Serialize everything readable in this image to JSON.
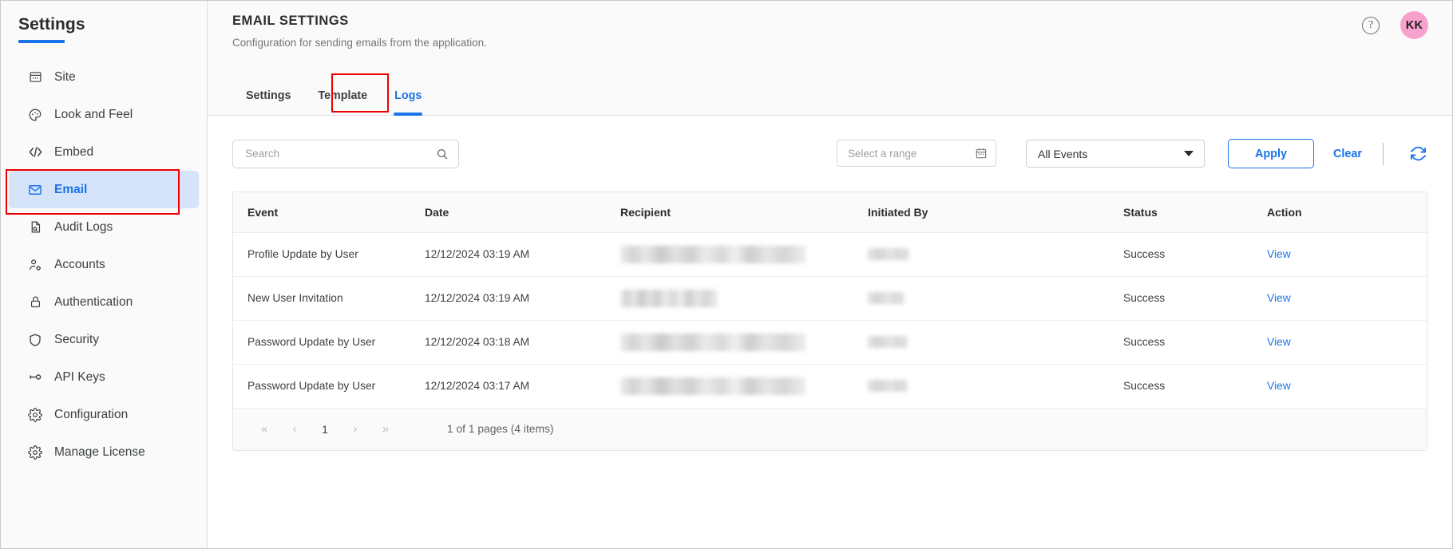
{
  "sidebar": {
    "title": "Settings",
    "items": [
      {
        "label": "Site",
        "icon": "site-icon",
        "active": false
      },
      {
        "label": "Look and Feel",
        "icon": "palette-icon",
        "active": false
      },
      {
        "label": "Embed",
        "icon": "code-icon",
        "active": false
      },
      {
        "label": "Email",
        "icon": "envelope-icon",
        "active": true
      },
      {
        "label": "Audit Logs",
        "icon": "document-search-icon",
        "active": false
      },
      {
        "label": "Accounts",
        "icon": "person-gear-icon",
        "active": false
      },
      {
        "label": "Authentication",
        "icon": "lock-icon",
        "active": false
      },
      {
        "label": "Security",
        "icon": "shield-icon",
        "active": false
      },
      {
        "label": "API Keys",
        "icon": "key-icon",
        "active": false
      },
      {
        "label": "Configuration",
        "icon": "gear-icon",
        "active": false
      },
      {
        "label": "Manage License",
        "icon": "gear-license-icon",
        "active": false
      }
    ]
  },
  "header": {
    "title": "EMAIL SETTINGS",
    "subtitle": "Configuration for sending emails from the application.",
    "help_icon": "question-mark-icon",
    "avatar_initials": "KK",
    "avatar_color": "#f9a1cd"
  },
  "tabs": [
    {
      "label": "Settings",
      "active": false
    },
    {
      "label": "Template",
      "active": false
    },
    {
      "label": "Logs",
      "active": true
    }
  ],
  "toolbar": {
    "search_placeholder": "Search",
    "search_value": "",
    "date_range_placeholder": "Select a range",
    "event_filter_value": "All Events",
    "apply_label": "Apply",
    "clear_label": "Clear",
    "refresh_icon": "refresh-icon"
  },
  "table": {
    "columns": [
      "Event",
      "Date",
      "Recipient",
      "Initiated By",
      "Status",
      "Action"
    ],
    "rows": [
      {
        "event": "Profile Update by User",
        "date": "12/12/2024 03:19 AM",
        "recipient": "",
        "recipient_redacted": true,
        "recipient_width": 232,
        "initiated_by": "",
        "initiated_by_redacted": true,
        "initiated_by_width": 52,
        "status": "Success",
        "action": "View"
      },
      {
        "event": "New User Invitation",
        "date": "12/12/2024 03:19 AM",
        "recipient": "",
        "recipient_redacted": true,
        "recipient_width": 122,
        "initiated_by": "",
        "initiated_by_redacted": true,
        "initiated_by_width": 46,
        "status": "Success",
        "action": "View"
      },
      {
        "event": "Password Update by User",
        "date": "12/12/2024 03:18 AM",
        "recipient": "",
        "recipient_redacted": true,
        "recipient_width": 232,
        "initiated_by": "",
        "initiated_by_redacted": true,
        "initiated_by_width": 50,
        "status": "Success",
        "action": "View"
      },
      {
        "event": "Password Update by User",
        "date": "12/12/2024 03:17 AM",
        "recipient": "",
        "recipient_redacted": true,
        "recipient_width": 232,
        "initiated_by": "",
        "initiated_by_redacted": true,
        "initiated_by_width": 50,
        "status": "Success",
        "action": "View"
      }
    ]
  },
  "pagination": {
    "first_label": "«",
    "prev_label": "‹",
    "current_page": "1",
    "next_label": "›",
    "last_label": "»",
    "info": "1 of 1 pages (4 items)"
  },
  "accents": {
    "primary": "#1a73e8",
    "highlight_box": "#ee0000",
    "sidebar_bg": "#fafafa",
    "active_nav_bg": "#d6e4fb"
  }
}
